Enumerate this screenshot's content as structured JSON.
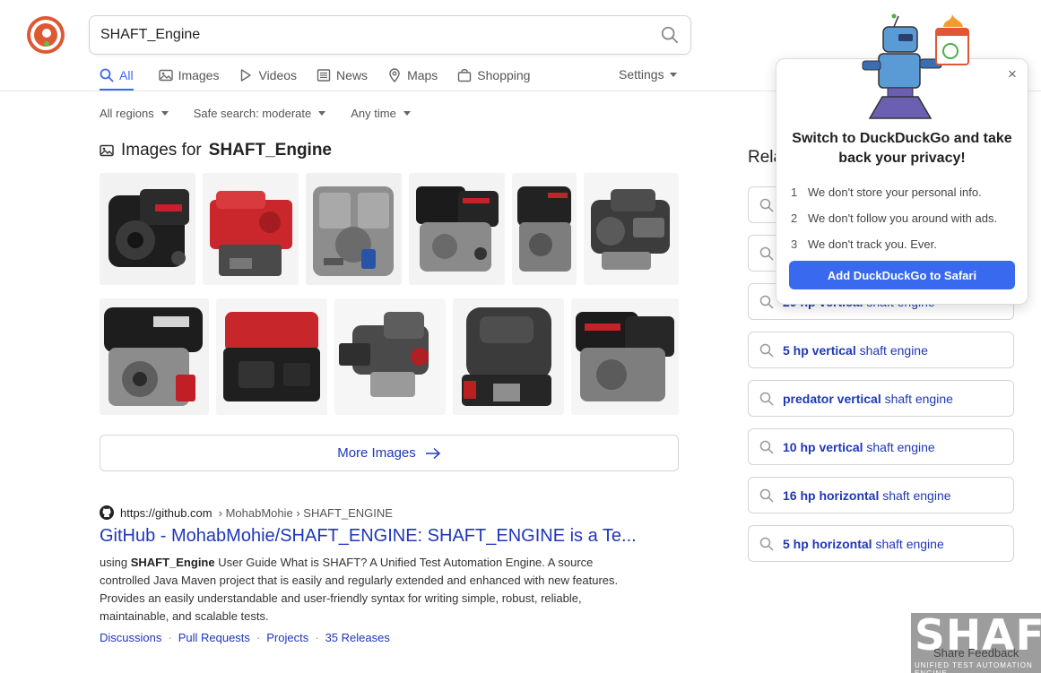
{
  "search": {
    "query": "SHAFT_Engine"
  },
  "nav": {
    "items": [
      {
        "label": "All",
        "icon": "search-icon"
      },
      {
        "label": "Images",
        "icon": "image-icon"
      },
      {
        "label": "Videos",
        "icon": "play-icon"
      },
      {
        "label": "News",
        "icon": "news-icon"
      },
      {
        "label": "Maps",
        "icon": "map-pin-icon"
      },
      {
        "label": "Shopping",
        "icon": "shopping-bag-icon"
      }
    ],
    "settings_label": "Settings"
  },
  "filters": {
    "region": "All regions",
    "safe_search": "Safe search: moderate",
    "time": "Any time"
  },
  "images_module": {
    "heading_prefix": "Images for",
    "heading_query": "SHAFT_Engine",
    "more_label": "More Images"
  },
  "result": {
    "host": "https://github.com",
    "path": "› MohabMohie › SHAFT_ENGINE",
    "title": "GitHub - MohabMohie/SHAFT_ENGINE: SHAFT_ENGINE is a Te...",
    "snippet_lead": "using",
    "snippet_bold": "SHAFT_Engine",
    "snippet_rest": "User Guide What is SHAFT? A Unified Test Automation Engine. A source controlled Java Maven project that is easily and regularly extended and enhanced with new features. Provides an easily understandable and user-friendly syntax for writing simple, robust, reliable, maintainable, and scalable tests.",
    "links": [
      "Discussions",
      "Pull Requests",
      "Projects",
      "35 Releases"
    ]
  },
  "related": {
    "heading": "Rela",
    "items": [
      {
        "bold": "",
        "rest": ""
      },
      {
        "bold": "",
        "rest": ""
      },
      {
        "bold": "20 hp vertical",
        "rest": "shaft engine"
      },
      {
        "bold": "5 hp vertical",
        "rest": "shaft engine"
      },
      {
        "bold": "predator vertical",
        "rest": "shaft engine"
      },
      {
        "bold": "10 hp vertical",
        "rest": "shaft engine"
      },
      {
        "bold": "16 hp horizontal",
        "rest": "shaft engine"
      },
      {
        "bold": "5 hp horizontal",
        "rest": "shaft engine"
      }
    ]
  },
  "popup": {
    "title": "Switch to DuckDuckGo and take back your privacy!",
    "points": [
      {
        "num": "1",
        "text": "We don't store your personal info."
      },
      {
        "num": "2",
        "text": "We don't follow you around with ads."
      },
      {
        "num": "3",
        "text": "We don't track you. Ever."
      }
    ],
    "button_label": "Add DuckDuckGo to Safari",
    "close_label": "×"
  },
  "watermark": {
    "big": "SHAFT",
    "small": "UNIFIED TEST AUTOMATION ENGINE"
  },
  "feedback_label": "Share Feedback",
  "colors": {
    "accent": "#3969ef",
    "link": "#1f37b9",
    "brand": "#de5833"
  }
}
